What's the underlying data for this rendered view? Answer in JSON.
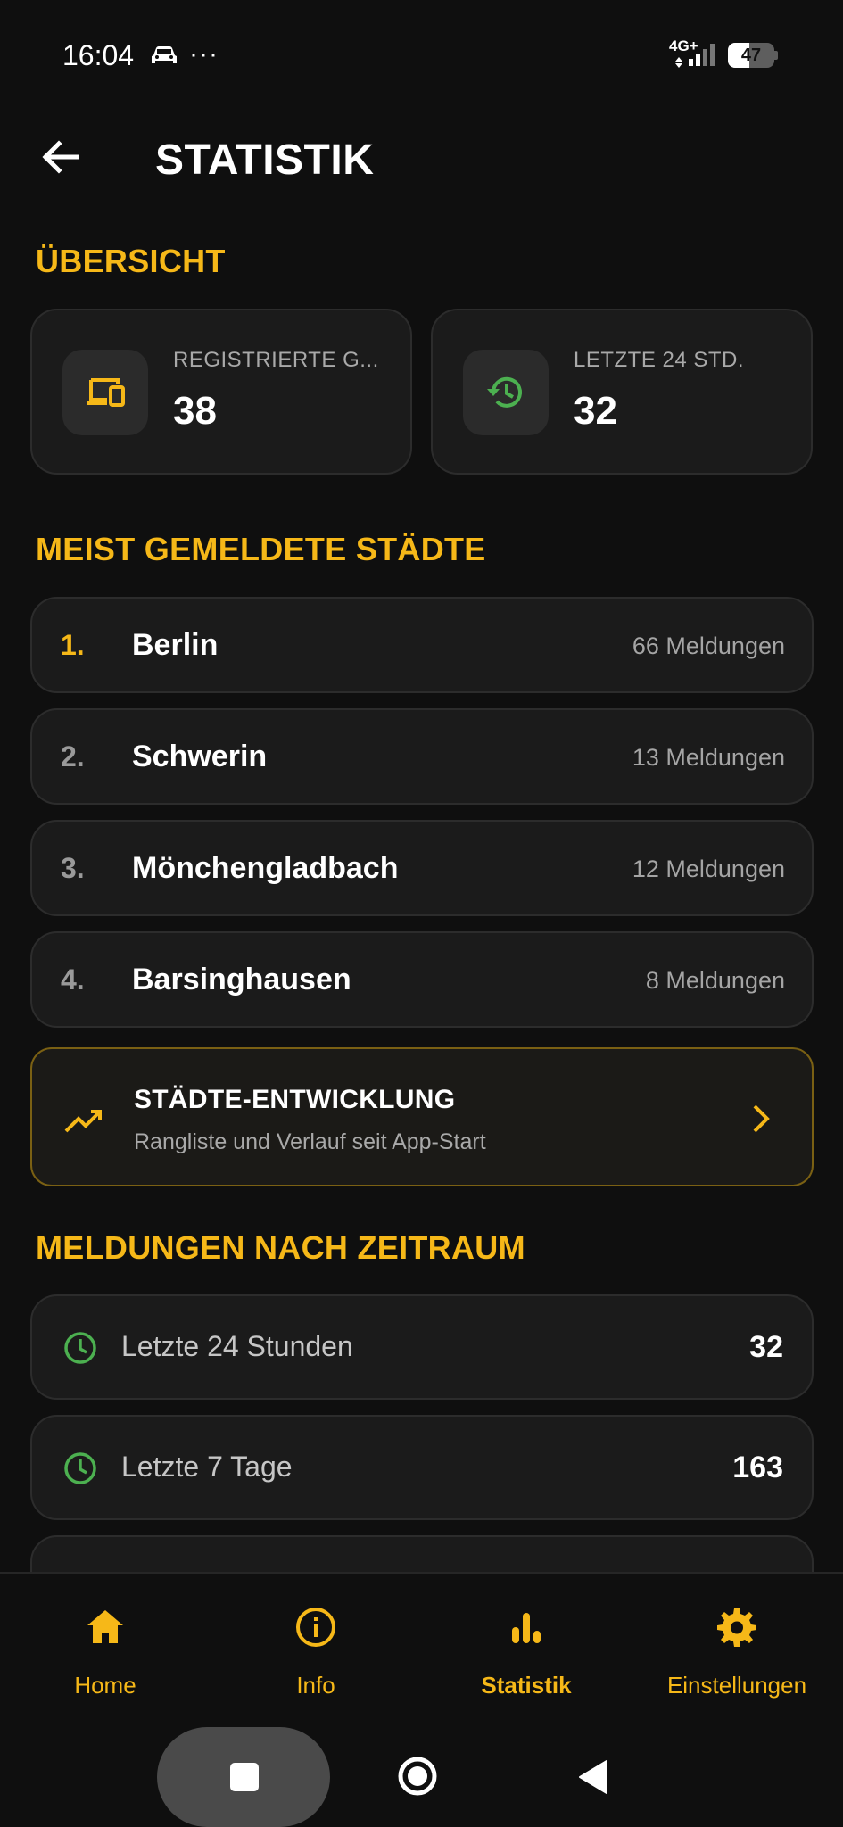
{
  "status_bar": {
    "time": "16:04",
    "dots": "···",
    "network": "4G+",
    "battery": "47",
    "battery_level": 0.47,
    "icons": [
      "car-icon",
      "signal-icon",
      "battery-icon"
    ]
  },
  "header": {
    "title": "STATISTIK",
    "back_icon": "arrow-back-icon"
  },
  "overview": {
    "heading": "ÜBERSICHT",
    "cards": [
      {
        "label": "REGISTRIERTE G...",
        "value": "38",
        "icon": "devices-icon",
        "icon_color": "#f6b818"
      },
      {
        "label": "LETZTE 24 STD.",
        "value": "32",
        "icon": "history-icon",
        "icon_color": "#4cb050"
      }
    ]
  },
  "top_cities": {
    "heading": "MEIST GEMELDETE STÄDTE",
    "items": [
      {
        "rank": "1.",
        "name": "Berlin",
        "count": "66 Meldungen"
      },
      {
        "rank": "2.",
        "name": "Schwerin",
        "count": "13 Meldungen"
      },
      {
        "rank": "3.",
        "name": "Mönchengladbach",
        "count": "12 Meldungen"
      },
      {
        "rank": "4.",
        "name": "Barsinghausen",
        "count": "8 Meldungen"
      }
    ]
  },
  "trend": {
    "title": "STÄDTE-ENTWICKLUNG",
    "subtitle": "Rangliste und Verlauf seit App-Start",
    "icon": "trending-up-icon",
    "chevron": "chevron-right-icon"
  },
  "periods": {
    "heading": "MELDUNGEN NACH ZEITRAUM",
    "items": [
      {
        "label": "Letzte 24 Stunden",
        "value": "32",
        "icon": "clock-icon"
      },
      {
        "label": "Letzte 7 Tage",
        "value": "163",
        "icon": "clock-icon"
      }
    ]
  },
  "bottom_nav": {
    "items": [
      {
        "label": "Home",
        "icon": "home-icon"
      },
      {
        "label": "Info",
        "icon": "info-icon"
      },
      {
        "label": "Statistik",
        "icon": "bar-chart-icon",
        "active": true
      },
      {
        "label": "Einstellungen",
        "icon": "gear-icon"
      }
    ]
  },
  "colors": {
    "accent": "#f6b818",
    "green": "#4cb050",
    "background": "#0f0f0f",
    "card": "#1b1b1b"
  }
}
